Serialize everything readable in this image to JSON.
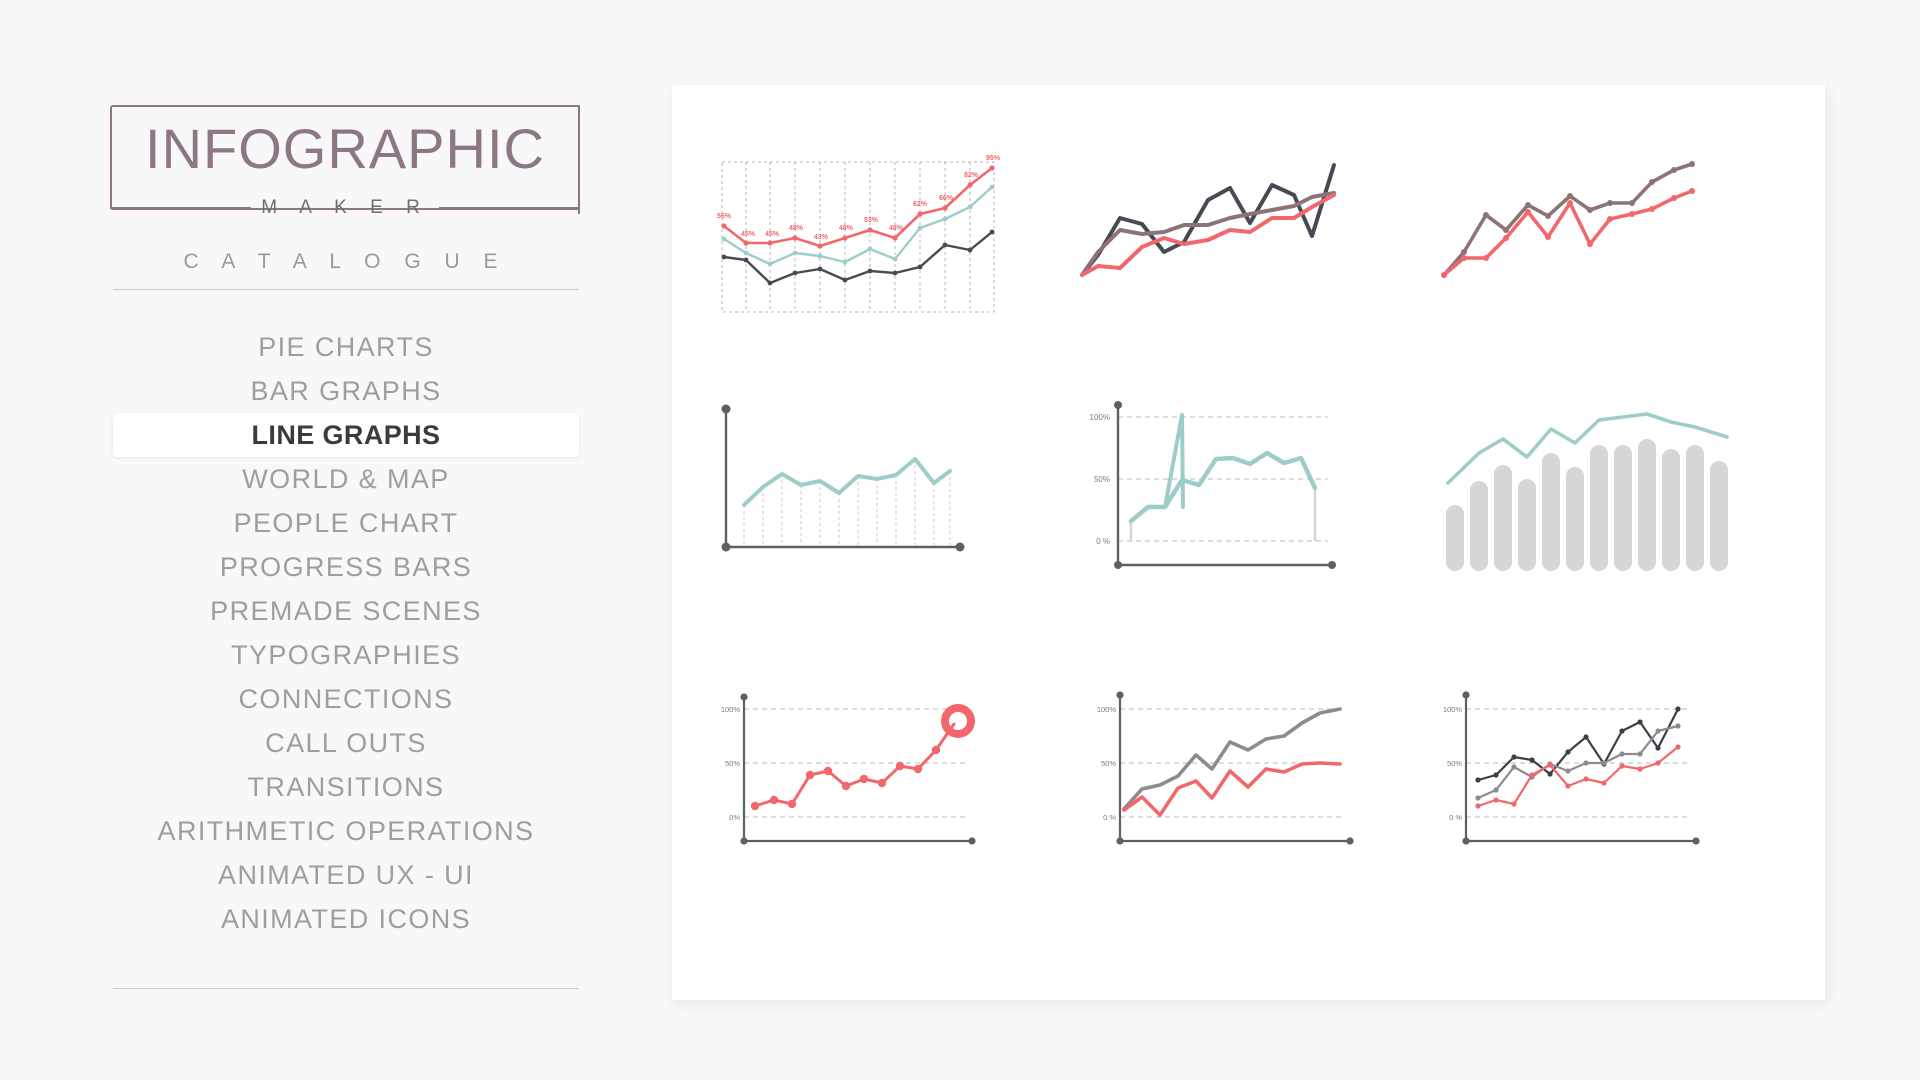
{
  "app": {
    "background_color": "#f8f8f8",
    "panel_color": "#ffffff"
  },
  "sidebar": {
    "logo": {
      "title": "INFOGRAPHIC",
      "subtitle": "M A K E R",
      "color": "#8d7786"
    },
    "catalogue_label": "C A T A L O G U E",
    "items": [
      {
        "label": "PIE CHARTS",
        "active": false
      },
      {
        "label": "BAR GRAPHS",
        "active": false
      },
      {
        "label": "LINE GRAPHS",
        "active": true
      },
      {
        "label": "WORLD & MAP",
        "active": false
      },
      {
        "label": "PEOPLE CHART",
        "active": false
      },
      {
        "label": "PROGRESS BARS",
        "active": false
      },
      {
        "label": "PREMADE SCENES",
        "active": false
      },
      {
        "label": "TYPOGRAPHIES",
        "active": false
      },
      {
        "label": "CONNECTIONS",
        "active": false
      },
      {
        "label": "CALL OUTS",
        "active": false
      },
      {
        "label": "TRANSITIONS",
        "active": false
      },
      {
        "label": "ARITHMETIC OPERATIONS",
        "active": false
      },
      {
        "label": "ANIMATED UX - UI",
        "active": false
      },
      {
        "label": "ANIMATED ICONS",
        "active": false
      }
    ]
  },
  "colors": {
    "red": "#f2676b",
    "teal": "#9ecdc9",
    "dark": "#454b54",
    "mauve": "#8d7378",
    "gray": "#8b8b90",
    "bar_gray": "#d6d6d6",
    "axis": "#5b5f66",
    "grid": "#b9b9bd"
  },
  "chart_data": [
    {
      "id": "grid-line-3series-labeled",
      "type": "line",
      "title": "",
      "grid": "vertical-dashed-box",
      "axis_labels": false,
      "data_labels": true,
      "x": [
        1,
        2,
        3,
        4,
        5,
        6,
        7,
        8,
        9,
        10,
        11,
        12
      ],
      "series": [
        {
          "name": "red",
          "color": "#f2676b",
          "values": [
            56,
            45,
            45,
            48,
            43,
            48,
            53,
            48,
            62,
            66,
            82,
            95
          ],
          "labels": [
            "56%",
            "45%",
            "45%",
            "48%",
            "43%",
            "48%",
            "53%",
            "48%",
            "62%",
            "66%",
            "82%",
            "95%"
          ]
        },
        {
          "name": "teal",
          "color": "#9ecdc9",
          "values": [
            47,
            38,
            32,
            38,
            36,
            33,
            41,
            35,
            52,
            58,
            66,
            80
          ]
        },
        {
          "name": "dark",
          "color": "#454b54",
          "values": [
            35,
            33,
            19,
            26,
            28,
            21,
            27,
            26,
            30,
            42,
            39,
            50
          ]
        }
      ],
      "ylim": [
        10,
        100
      ]
    },
    {
      "id": "freeform-3series",
      "type": "line",
      "grid": "none",
      "axis_labels": false,
      "x": [
        0,
        1,
        2,
        3,
        4,
        5,
        6,
        7,
        8,
        9,
        10,
        11,
        12
      ],
      "series": [
        {
          "name": "dark",
          "color": "#454b54",
          "values": [
            2,
            30,
            62,
            58,
            38,
            46,
            80,
            88,
            64,
            90,
            84,
            56,
            96
          ]
        },
        {
          "name": "mauve",
          "color": "#8d7378",
          "values": [
            2,
            34,
            52,
            48,
            50,
            56,
            56,
            62,
            66,
            70,
            74,
            82,
            86
          ]
        },
        {
          "name": "red",
          "color": "#f2676b",
          "values": [
            2,
            12,
            10,
            28,
            36,
            30,
            34,
            42,
            40,
            52,
            52,
            62,
            74
          ]
        }
      ],
      "ylim": [
        0,
        100
      ]
    },
    {
      "id": "marker-2series",
      "type": "line",
      "grid": "none",
      "axis_labels": false,
      "markers": true,
      "x": [
        0,
        1,
        2,
        3,
        4,
        5,
        6,
        7,
        8,
        9,
        10,
        11,
        12
      ],
      "series": [
        {
          "name": "mauve",
          "color": "#8d7378",
          "values": [
            4,
            26,
            56,
            46,
            62,
            54,
            68,
            58,
            62,
            62,
            76,
            84,
            90
          ]
        },
        {
          "name": "red",
          "color": "#f2676b",
          "values": [
            4,
            22,
            22,
            38,
            58,
            40,
            62,
            36,
            52,
            56,
            60,
            70,
            76
          ]
        }
      ],
      "ylim": [
        0,
        100
      ]
    },
    {
      "id": "teal-droplines",
      "type": "line",
      "grid": "vertical-dotted",
      "axis": "L-shape-dots",
      "axis_labels": false,
      "x": [
        1,
        2,
        3,
        4,
        5,
        6,
        7,
        8,
        9,
        10,
        11,
        12
      ],
      "series": [
        {
          "name": "teal",
          "color": "#9ecdc9",
          "values": [
            28,
            46,
            58,
            48,
            52,
            42,
            57,
            54,
            58,
            70,
            50,
            60
          ]
        }
      ],
      "ylim": [
        0,
        100
      ]
    },
    {
      "id": "teal-percent-axis",
      "type": "line",
      "grid": "horizontal-dashed",
      "axis": "L-shape-dots",
      "yticks": [
        "0 %",
        "50%",
        "100%"
      ],
      "x": [
        1,
        2,
        3,
        4,
        5,
        6,
        7,
        8,
        9,
        10,
        11,
        12
      ],
      "series": [
        {
          "name": "teal",
          "color": "#9ecdc9",
          "values": [
            16,
            29,
            29,
            52,
            47,
            64,
            65,
            60,
            69,
            59,
            65,
            54
          ]
        }
      ],
      "ylim": [
        0,
        110
      ]
    },
    {
      "id": "bars-with-teal-line",
      "type": "bar",
      "grid": "none",
      "axis_labels": false,
      "categories": [
        1,
        2,
        3,
        4,
        5,
        6,
        7,
        8,
        9,
        10,
        11,
        12
      ],
      "values": [
        28,
        50,
        62,
        46,
        70,
        52,
        78,
        76,
        80,
        70,
        72,
        58
      ],
      "overlay_series": {
        "name": "teal",
        "color": "#9ecdc9",
        "values": [
          46,
          68,
          58,
          80,
          66,
          92,
          90,
          92,
          86,
          80,
          84,
          74
        ]
      },
      "ylim": [
        0,
        100
      ]
    },
    {
      "id": "red-dots-donut",
      "type": "line",
      "grid": "horizontal-dashed",
      "axis": "L-shape-dots",
      "markers": true,
      "end_marker": "donut",
      "yticks": [
        "0%",
        "50%",
        "100%"
      ],
      "x": [
        1,
        2,
        3,
        4,
        5,
        6,
        7,
        8,
        9,
        10,
        11,
        12,
        13
      ],
      "series": [
        {
          "name": "red",
          "color": "#f2676b",
          "values": [
            10,
            17,
            14,
            38,
            43,
            27,
            35,
            30,
            46,
            43,
            61,
            86,
            86
          ]
        }
      ],
      "ylim": [
        0,
        110
      ]
    },
    {
      "id": "two-series-percent",
      "type": "line",
      "grid": "horizontal-dashed",
      "axis": "L-shape-dots",
      "yticks": [
        "0 %",
        "50%",
        "100%"
      ],
      "x": [
        1,
        2,
        3,
        4,
        5,
        6,
        7,
        8,
        9,
        10,
        11,
        12,
        13,
        14
      ],
      "series": [
        {
          "name": "gray",
          "color": "#8b8b90",
          "values": [
            8,
            27,
            30,
            38,
            56,
            45,
            68,
            62,
            70,
            72,
            84,
            100,
            100
          ]
        },
        {
          "name": "red",
          "color": "#f2676b",
          "values": [
            7,
            19,
            4,
            28,
            34,
            19,
            43,
            28,
            45,
            42,
            50,
            51,
            50
          ]
        }
      ],
      "ylim": [
        0,
        110
      ]
    },
    {
      "id": "three-series-markers-percent",
      "type": "line",
      "grid": "horizontal-dashed",
      "axis": "L-shape-dots",
      "markers": true,
      "yticks": [
        "0 %",
        "50%",
        "100%"
      ],
      "x": [
        1,
        2,
        3,
        4,
        5,
        6,
        7,
        8,
        9,
        10,
        11,
        12,
        13
      ],
      "series": [
        {
          "name": "dark",
          "color": "#3b3f46",
          "values": [
            34,
            39,
            56,
            53,
            40,
            60,
            74,
            49,
            79,
            88,
            64,
            99
          ]
        },
        {
          "name": "gray",
          "color": "#8b8b90",
          "values": [
            18,
            25,
            43,
            34,
            47,
            39,
            48,
            48,
            57,
            57,
            78,
            84
          ]
        },
        {
          "name": "red",
          "color": "#f2676b",
          "values": [
            10,
            17,
            14,
            38,
            48,
            27,
            35,
            30,
            45,
            42,
            50,
            65
          ]
        }
      ],
      "ylim": [
        0,
        110
      ]
    }
  ]
}
